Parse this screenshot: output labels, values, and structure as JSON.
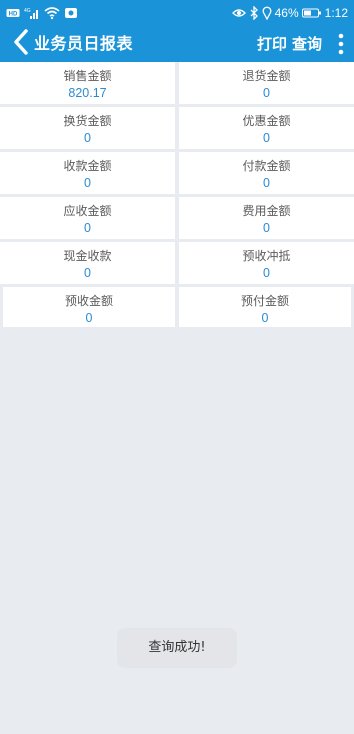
{
  "status_bar": {
    "battery_text": "46%",
    "time": "1:12"
  },
  "app_bar": {
    "title": "业务员日报表",
    "print_label": "打印",
    "query_label": "查询"
  },
  "metrics": [
    {
      "label": "销售金额",
      "value": "820.17"
    },
    {
      "label": "退货金额",
      "value": "0"
    },
    {
      "label": "换货金额",
      "value": "0"
    },
    {
      "label": "优惠金额",
      "value": "0"
    },
    {
      "label": "收款金额",
      "value": "0"
    },
    {
      "label": "付款金额",
      "value": "0"
    },
    {
      "label": "应收金额",
      "value": "0"
    },
    {
      "label": "费用金额",
      "value": "0"
    },
    {
      "label": "现金收款",
      "value": "0"
    },
    {
      "label": "预收冲抵",
      "value": "0"
    },
    {
      "label": "预收金额",
      "value": "0"
    },
    {
      "label": "预付金额",
      "value": "0"
    }
  ],
  "toast": {
    "message": "查询成功!"
  },
  "colors": {
    "primary": "#1a93d9",
    "value_text": "#2a8bd5",
    "background": "#e8ebef"
  }
}
